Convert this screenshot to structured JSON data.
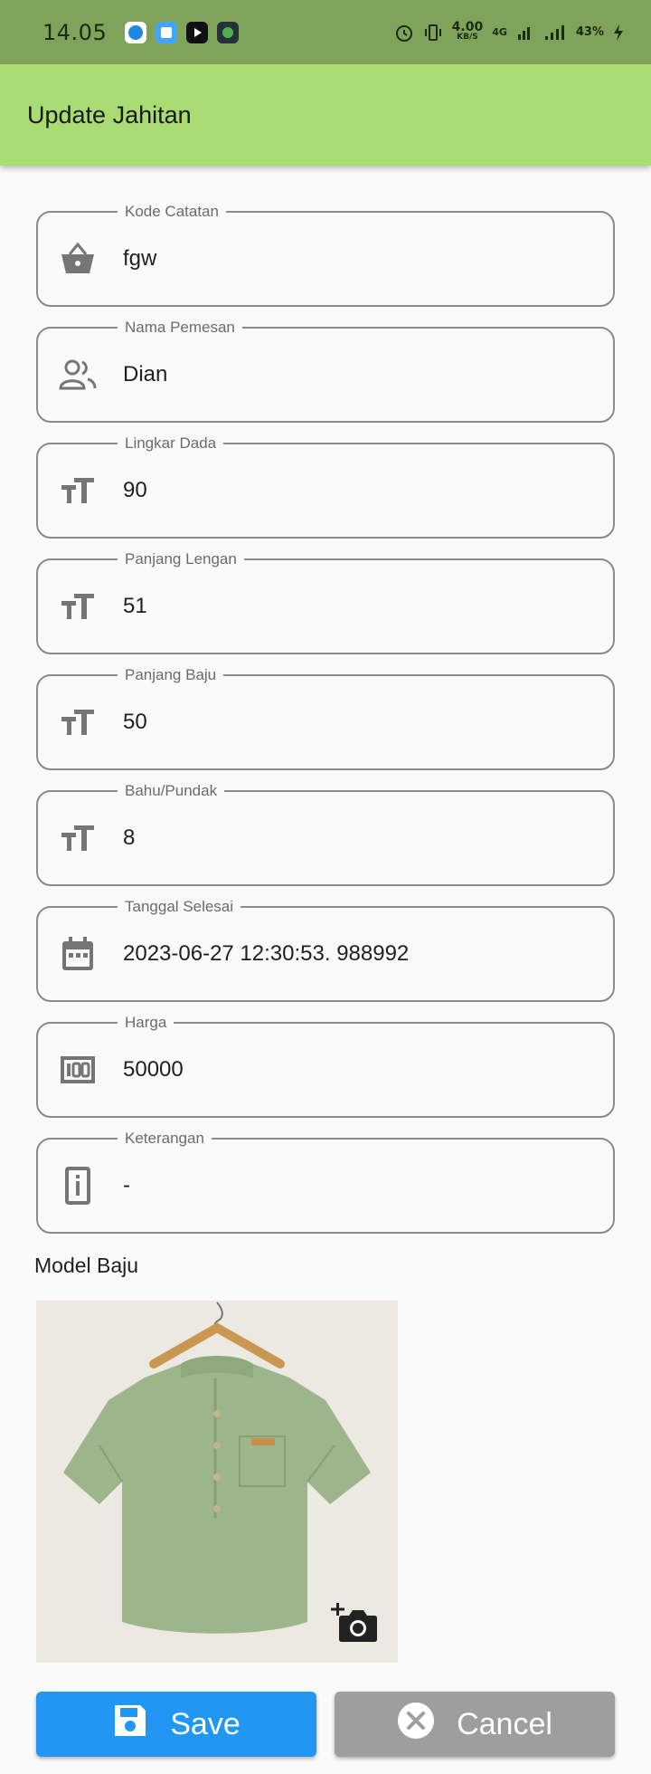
{
  "status_bar": {
    "time": "14.05",
    "net_speed": "4.00",
    "net_unit": "KB/S",
    "network": "4G",
    "battery": "43%"
  },
  "app_bar": {
    "title": "Update Jahitan"
  },
  "fields": [
    {
      "label": "Kode Catatan",
      "value": "fgw",
      "icon": "basket-icon"
    },
    {
      "label": "Nama Pemesan",
      "value": "Dian",
      "icon": "people-icon"
    },
    {
      "label": "Lingkar Dada",
      "value": "90",
      "icon": "text-size-icon"
    },
    {
      "label": "Panjang Lengan",
      "value": "51",
      "icon": "text-size-icon"
    },
    {
      "label": "Panjang Baju",
      "value": "50",
      "icon": "text-size-icon"
    },
    {
      "label": "Bahu/Pundak",
      "value": "8",
      "icon": "text-size-icon"
    },
    {
      "label": "Tanggal Selesai",
      "value": "2023-06-27 12:30:53. 988992",
      "icon": "calendar-icon"
    },
    {
      "label": "Harga",
      "value": "50000",
      "icon": "money-100-icon"
    },
    {
      "label": "Keterangan",
      "value": "-",
      "icon": "info-icon"
    }
  ],
  "model_section": {
    "title": "Model Baju"
  },
  "buttons": {
    "save": "Save",
    "cancel": "Cancel"
  },
  "colors": {
    "status_bar": "#7fa35b",
    "app_bar": "#a9dc73",
    "save": "#2196f3",
    "cancel": "#9e9e9e",
    "icon": "#757575"
  }
}
